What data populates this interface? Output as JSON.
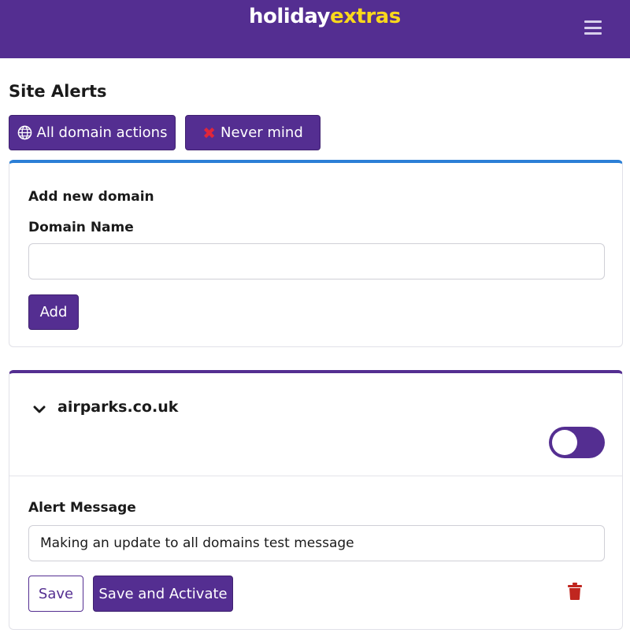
{
  "header": {
    "logo_part1": "holiday",
    "logo_part2": "extras",
    "brand_color": "#542e91",
    "accent_color": "#f9d71c",
    "menu_icon": "hamburger-icon"
  },
  "page": {
    "title": "Site Alerts"
  },
  "actions": {
    "all_domains_label": "All domain actions",
    "all_domains_icon": "globe-icon",
    "never_mind_label": "Never mind",
    "never_mind_icon": "close-icon"
  },
  "add_domain": {
    "heading": "Add new domain",
    "field_label": "Domain Name",
    "field_value": "",
    "field_placeholder": "",
    "add_label": "Add"
  },
  "domains": [
    {
      "name": "airparks.co.uk",
      "expanded": true,
      "active": false,
      "alert_label": "Alert Message",
      "alert_message": "Making an update to all domains test message",
      "save_label": "Save",
      "save_activate_label": "Save and Activate",
      "delete_icon": "trash-icon"
    }
  ]
}
